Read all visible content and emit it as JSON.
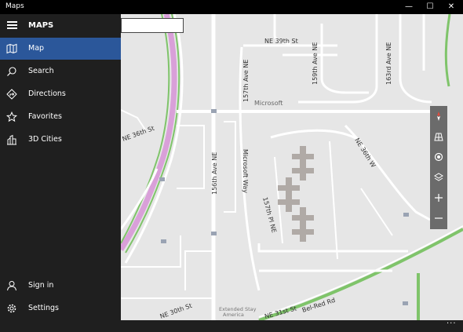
{
  "window": {
    "title": "Maps",
    "min": "—",
    "max": "☐",
    "close": "✕"
  },
  "app": {
    "name": "MAPS"
  },
  "nav": {
    "items": [
      {
        "label": "Map",
        "icon": "map-icon",
        "active": true
      },
      {
        "label": "Search",
        "icon": "search-icon"
      },
      {
        "label": "Directions",
        "icon": "directions-icon"
      },
      {
        "label": "Favorites",
        "icon": "star-icon"
      },
      {
        "label": "3D Cities",
        "icon": "3d-cities-icon"
      }
    ],
    "bottom": [
      {
        "label": "Sign in",
        "icon": "person-icon"
      },
      {
        "label": "Settings",
        "icon": "gear-icon"
      }
    ]
  },
  "search": {
    "placeholder": "",
    "value": ""
  },
  "map": {
    "labels": {
      "ne39": "NE 39th St",
      "ave157": "157th Ave NE",
      "ave159": "159th Ave NE",
      "ave163": "163rd Ave NE",
      "microsoft": "Microsoft",
      "ne36": "NE 36th St",
      "ave156": "156th Ave NE",
      "msway": "Microsoft Way",
      "ne36th": "NE 36th W",
      "pl157": "157th Pl NE",
      "belred": "Bel-Red Rd",
      "extended": "Extended Stay",
      "america": "America",
      "ne30": "NE 30th St",
      "ne31": "NE 31st St"
    }
  },
  "more_label": "..."
}
